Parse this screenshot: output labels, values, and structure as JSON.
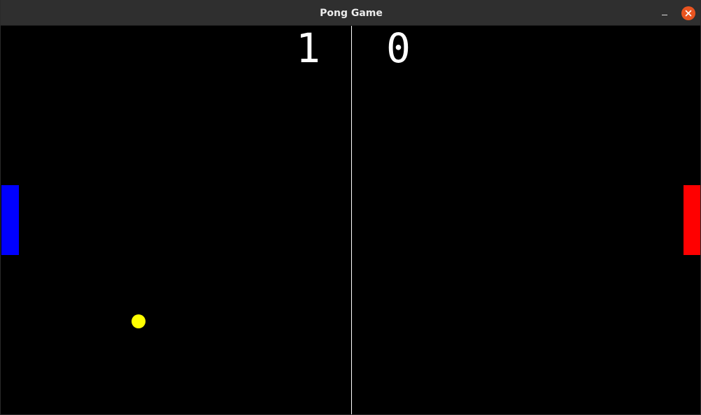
{
  "window": {
    "title": "Pong Game"
  },
  "scores": {
    "left": "1",
    "right": "0"
  },
  "colors": {
    "left_paddle": "#0000ff",
    "right_paddle": "#ff0000",
    "ball": "#ffff00",
    "background": "#000000",
    "center_line": "#ffffff"
  },
  "icons": {
    "minimize": "minimize-icon",
    "close": "close-icon"
  }
}
